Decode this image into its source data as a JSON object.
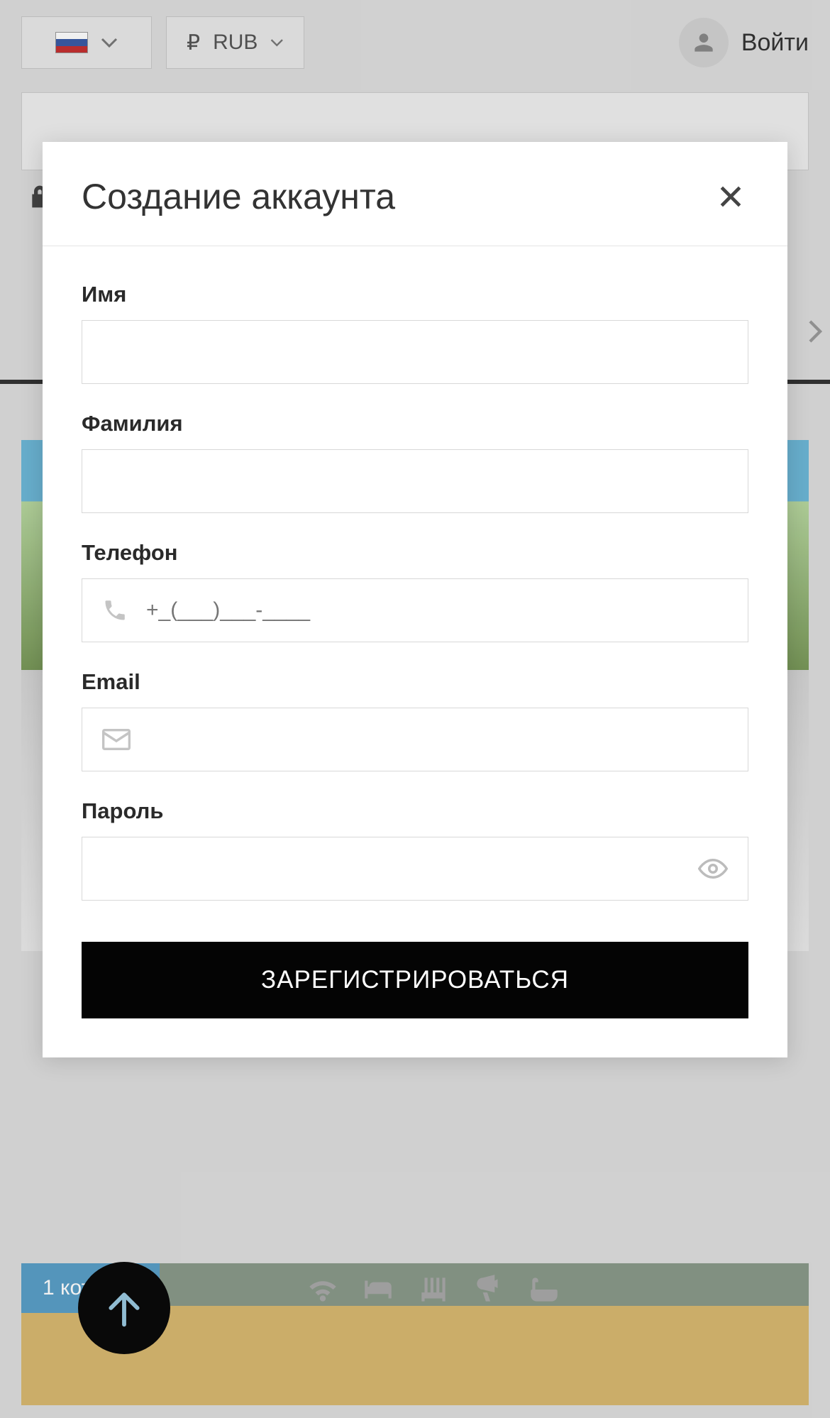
{
  "header": {
    "language_flag": "ru",
    "currency_symbol": "₽",
    "currency_code": "RUB",
    "login_label": "Войти"
  },
  "background": {
    "card_badge": "1 коттедж"
  },
  "modal": {
    "title": "Создание аккаунта",
    "fields": {
      "name_label": "Имя",
      "surname_label": "Фамилия",
      "phone_label": "Телефон",
      "phone_placeholder": "+_(___)___-____",
      "email_label": "Email",
      "password_label": "Пароль"
    },
    "submit_label": "ЗАРЕГИСТРИРОВАТЬСЯ"
  }
}
